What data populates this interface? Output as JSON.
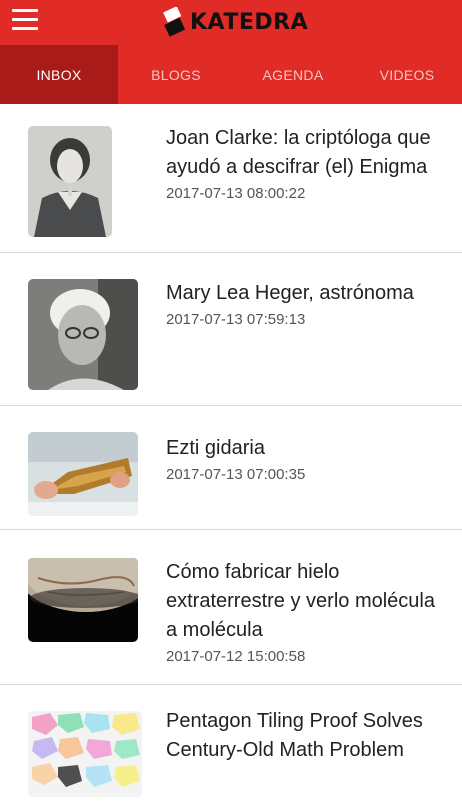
{
  "app": {
    "name": "KATEDRA"
  },
  "colors": {
    "header": "#e02b27",
    "active_tab": "#a91b18"
  },
  "icons": {
    "menu": "hamburger-menu-icon",
    "logo": "katedra-logo-icon"
  },
  "tabs": [
    {
      "label": "INBOX",
      "active": true
    },
    {
      "label": "BLOGS",
      "active": false
    },
    {
      "label": "AGENDA",
      "active": false
    },
    {
      "label": "VIDEOS",
      "active": false
    }
  ],
  "articles": [
    {
      "title": "Joan Clarke: la criptóloga que ayudó a descifrar (el) Enigma",
      "date": "2017-07-13 08:00:22"
    },
    {
      "title": "Mary Lea Heger, astrónoma",
      "date": "2017-07-13 07:59:13"
    },
    {
      "title": "Ezti gidaria",
      "date": "2017-07-13 07:00:35"
    },
    {
      "title": "Cómo fabricar hielo extraterrestre y verlo molécula a molécula",
      "date": "2017-07-12 15:00:58"
    },
    {
      "title": "Pentagon Tiling Proof Solves Century-Old Math Problem",
      "date": ""
    }
  ]
}
